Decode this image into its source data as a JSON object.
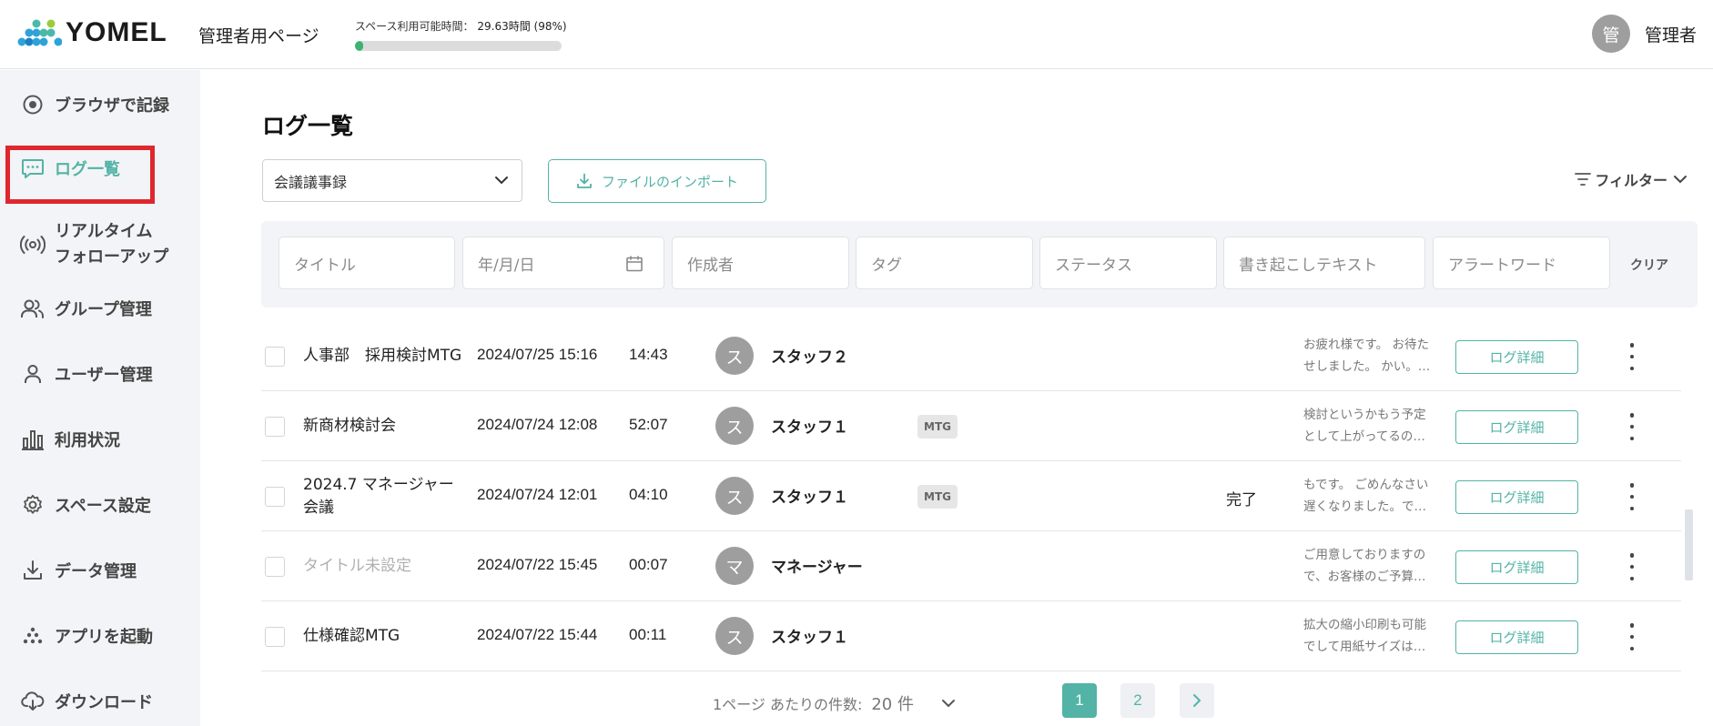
{
  "header": {
    "logo_text": "YOMEL",
    "page_label": "管理者用ページ",
    "usage_label": "スペース利用可能時間：",
    "usage_value": "29.63時間 (98%)",
    "usage_percent": 0.98,
    "user_avatar": "管",
    "user_name": "管理者"
  },
  "sidebar": {
    "items": [
      {
        "label": "ブラウザで記録",
        "icon": "record-icon"
      },
      {
        "label": "ログ一覧",
        "icon": "chat-icon",
        "active": true
      },
      {
        "label": "リアルタイム",
        "label2": "フォローアップ",
        "icon": "broadcast-icon"
      },
      {
        "label": "グループ管理",
        "icon": "group-icon"
      },
      {
        "label": "ユーザー管理",
        "icon": "user-icon"
      },
      {
        "label": "利用状況",
        "icon": "bar-chart-icon"
      },
      {
        "label": "スペース設定",
        "icon": "gear-icon"
      },
      {
        "label": "データ管理",
        "icon": "download-tray-icon"
      },
      {
        "label": "アプリを起動",
        "icon": "app-launch-icon"
      },
      {
        "label": "ダウンロード",
        "icon": "cloud-download-icon"
      }
    ]
  },
  "main": {
    "title": "ログ一覧",
    "type_select": "会議議事録",
    "import_label": "ファイルのインポート",
    "filter_label": "フィルター",
    "filters": {
      "title": "タイトル",
      "date": "年/月/日",
      "author": "作成者",
      "tag": "タグ",
      "status": "ステータス",
      "transcript": "書き起こしテキスト",
      "alert": "アラートワード",
      "clear": "クリア"
    },
    "rows": [
      {
        "title": "人事部　採用検討MTG",
        "date": "2024/07/25 15:16",
        "duration": "14:43",
        "avatar": "ス",
        "author": "スタッフ２",
        "tag": "",
        "status": "",
        "preview1": "お疲れ様です。 お待た",
        "preview2": "せしました。 かい。…",
        "detail": "ログ詳細"
      },
      {
        "title": "新商材検討会",
        "date": "2024/07/24 12:08",
        "duration": "52:07",
        "avatar": "ス",
        "author": "スタッフ１",
        "tag": "MTG",
        "status": "",
        "preview1": "検討というかもう予定",
        "preview2": "として上がってるの…",
        "detail": "ログ詳細"
      },
      {
        "title": "2024.7 マネージャー会議",
        "date": "2024/07/24 12:01",
        "duration": "04:10",
        "avatar": "ス",
        "author": "スタッフ１",
        "tag": "MTG",
        "status": "完了",
        "preview1": "もです。 ごめんなさい",
        "preview2": "遅くなりました。で…",
        "detail": "ログ詳細"
      },
      {
        "title": "タイトル未設定",
        "date": "2024/07/22 15:45",
        "duration": "00:07",
        "avatar": "マ",
        "author": "マネージャー",
        "tag": "",
        "status": "",
        "preview1": "ご用意しておりますの",
        "preview2": "で、お客様のご予算…",
        "detail": "ログ詳細"
      },
      {
        "title": "仕様確認MTG",
        "date": "2024/07/22 15:44",
        "duration": "00:11",
        "avatar": "ス",
        "author": "スタッフ１",
        "tag": "",
        "status": "",
        "preview1": "拡大の縮小印刷も可能",
        "preview2": "でして用紙サイズは…",
        "detail": "ログ詳細"
      }
    ],
    "pagination": {
      "per_page_label": "1ページ あたりの件数:",
      "per_page_value": "20 件",
      "pages": [
        "1",
        "2"
      ],
      "current": "1",
      "next": "›"
    }
  },
  "colors": {
    "accent": "#52b3a6",
    "highlight": "#e0262f",
    "usage_fill": "#3cb371"
  }
}
